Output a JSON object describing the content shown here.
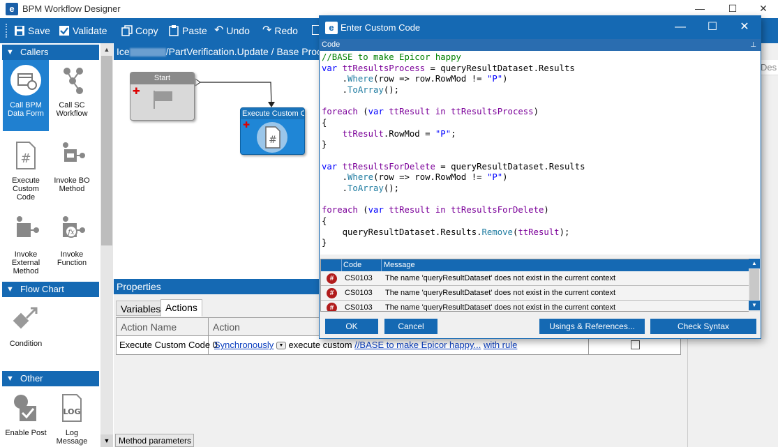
{
  "window": {
    "title": "BPM Workflow Designer",
    "min": "—",
    "max": "☐",
    "close": "✕"
  },
  "toolbar": {
    "save": "Save",
    "validate": "Validate",
    "copy": "Copy",
    "paste": "Paste",
    "undo": "Undo",
    "redo": "Redo"
  },
  "palette": {
    "callers": {
      "header": "Callers",
      "items": [
        "Call BPM Data Form",
        "Call SC Workflow",
        "Execute Custom Code",
        "Invoke BO Method",
        "Invoke External Method",
        "Invoke Function"
      ]
    },
    "flow_chart": {
      "header": "Flow Chart",
      "items": [
        "Condition"
      ]
    },
    "other": {
      "header": "Other",
      "items": [
        "Enable Post",
        "Log Message"
      ]
    }
  },
  "canvas": {
    "breadcrumb_prefix": "Ice",
    "breadcrumb_rest": "/PartVerification.Update / Base Proc",
    "nodes": {
      "start": "Start",
      "exec": "Execute Custom Co"
    }
  },
  "properties": {
    "header": "Properties",
    "tabs": [
      "Variables",
      "Actions"
    ],
    "columns": [
      "Action Name",
      "Action"
    ],
    "row": {
      "name": "Execute Custom Code 0",
      "sync": "Synchronously",
      "middle": "execute custom",
      "code_link": "//BASE to make Epicor happy...",
      "rule_link": "with rule"
    },
    "bottom_tab": "Method parameters"
  },
  "right_panel": {
    "label": "Des"
  },
  "dialog": {
    "title": "Enter Custom Code",
    "code_label": "Code",
    "pin": "⊥",
    "error_columns": [
      "Code",
      "Message"
    ],
    "errors": [
      {
        "code": "CS0103",
        "message": "The name 'queryResultDataset' does not exist in the current context"
      },
      {
        "code": "CS0103",
        "message": "The name 'queryResultDataset' does not exist in the current context"
      },
      {
        "code": "CS0103",
        "message": "The name 'queryResultDataset' does not exist in the current context"
      }
    ],
    "buttons": {
      "ok": "OK",
      "cancel": "Cancel",
      "usings": "Usings & References...",
      "check": "Check Syntax"
    }
  },
  "colors": {
    "accent": "#1569b3",
    "error_icon": "#b11c1c"
  }
}
